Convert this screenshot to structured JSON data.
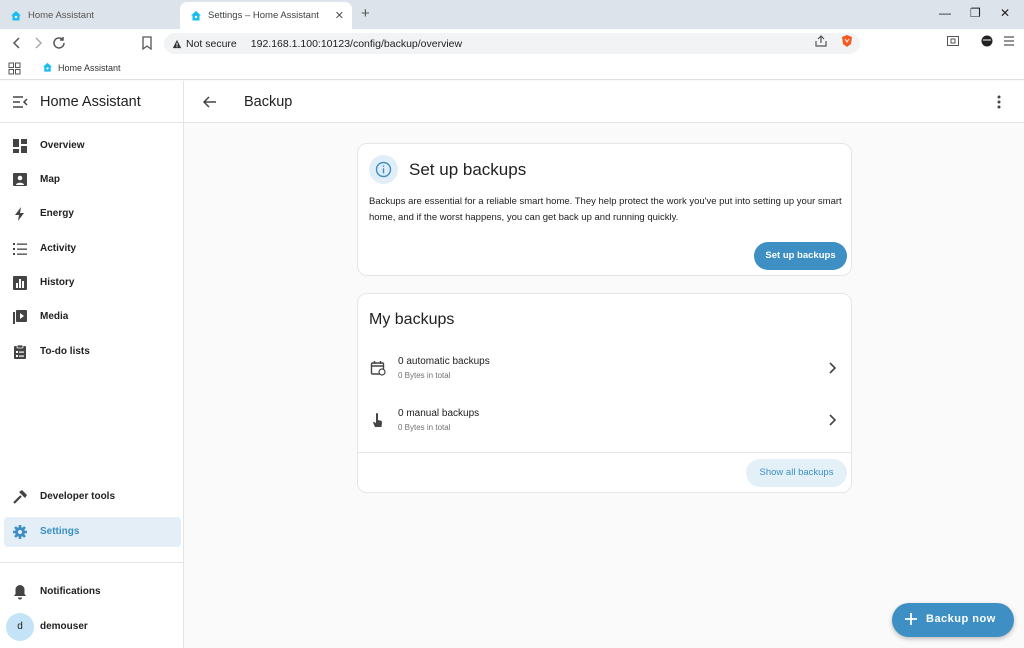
{
  "browser": {
    "tabs": [
      {
        "title": "Home Assistant",
        "active": false
      },
      {
        "title": "Settings – Home Assistant",
        "active": true
      }
    ],
    "security_label": "Not secure",
    "url": "192.168.1.100:10123/config/backup/overview",
    "bookmark": "Home Assistant",
    "window_controls": [
      "—",
      "❐",
      "✕"
    ]
  },
  "sidebar": {
    "title": "Home Assistant",
    "items": [
      {
        "label": "Overview",
        "icon": "dashboard-icon"
      },
      {
        "label": "Map",
        "icon": "map-icon"
      },
      {
        "label": "Energy",
        "icon": "lightning-icon"
      },
      {
        "label": "Activity",
        "icon": "list-icon"
      },
      {
        "label": "History",
        "icon": "chart-icon"
      },
      {
        "label": "Media",
        "icon": "media-icon"
      },
      {
        "label": "To-do lists",
        "icon": "clipboard-icon"
      }
    ],
    "bottom_items": [
      {
        "label": "Developer tools",
        "icon": "hammer-icon"
      },
      {
        "label": "Settings",
        "icon": "gear-icon",
        "selected": true
      }
    ],
    "notifications": "Notifications",
    "user": {
      "initial": "d",
      "name": "demouser"
    }
  },
  "page": {
    "title": "Backup"
  },
  "setup_card": {
    "title": "Set up backups",
    "description": "Backups are essential for a reliable smart home. They help protect the work you've put into setting up your smart home, and if the worst happens, you can get back up and running quickly.",
    "button": "Set up backups"
  },
  "backups_card": {
    "title": "My backups",
    "rows": [
      {
        "title": "0 automatic backups",
        "subtitle": "0 Bytes in total",
        "icon": "calendar-sync-icon"
      },
      {
        "title": "0 manual backups",
        "subtitle": "0 Bytes in total",
        "icon": "gesture-tap-icon"
      }
    ],
    "button": "Show all backups"
  },
  "fab": {
    "label": "Backup now"
  },
  "colors": {
    "primary": "#3d8fc4",
    "selected_bg": "#e3eef6",
    "tonal_bg": "#e3f0f8"
  }
}
